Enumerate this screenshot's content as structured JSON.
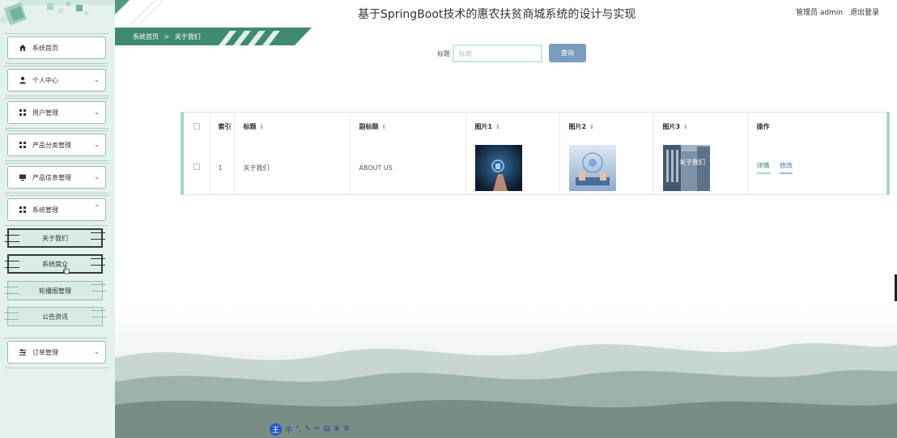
{
  "header": {
    "title": "基于SpringBoot技术的惠农扶贫商城系统的设计与实现",
    "user_label": "管理员 admin",
    "logout_label": "退出登录"
  },
  "breadcrumb": {
    "home": "系统首页",
    "separator": ">",
    "current": "关于我们"
  },
  "sidebar": {
    "items": [
      {
        "label": "系统首页",
        "icon": "home-icon"
      },
      {
        "label": "个人中心",
        "icon": "user-icon"
      },
      {
        "label": "用户管理",
        "icon": "grid-icon"
      },
      {
        "label": "产品分类管理",
        "icon": "grid-icon"
      },
      {
        "label": "产品信息管理",
        "icon": "monitor-icon"
      },
      {
        "label": "系统管理",
        "icon": "grid-icon"
      },
      {
        "label": "订单管理",
        "icon": "sliders-icon"
      }
    ],
    "sub_items": [
      {
        "label": "关于我们"
      },
      {
        "label": "系统简介"
      },
      {
        "label": "轮播图管理"
      },
      {
        "label": "公告资讯"
      }
    ]
  },
  "search": {
    "label": "标题",
    "placeholder": "标题",
    "button": "查询"
  },
  "table": {
    "columns": [
      "索引",
      "标题",
      "副标题",
      "图片1",
      "图片2",
      "图片3",
      "操作"
    ],
    "rows": [
      {
        "index": "1",
        "title": "关于我们",
        "subtitle": "ABOUT US",
        "detail": "详情",
        "edit": "修改"
      }
    ]
  },
  "ime_bar": {
    "logo": "王",
    "items": [
      "中",
      "°,",
      "✎",
      "✂",
      "▤",
      "♛",
      "⚙"
    ]
  },
  "colors": {
    "sidebar_bg": "#e4f1ec",
    "accent_green": "#a9d8c3",
    "search_button": "#7b9dbd",
    "breadcrumb_bar": "#3e8a72"
  }
}
